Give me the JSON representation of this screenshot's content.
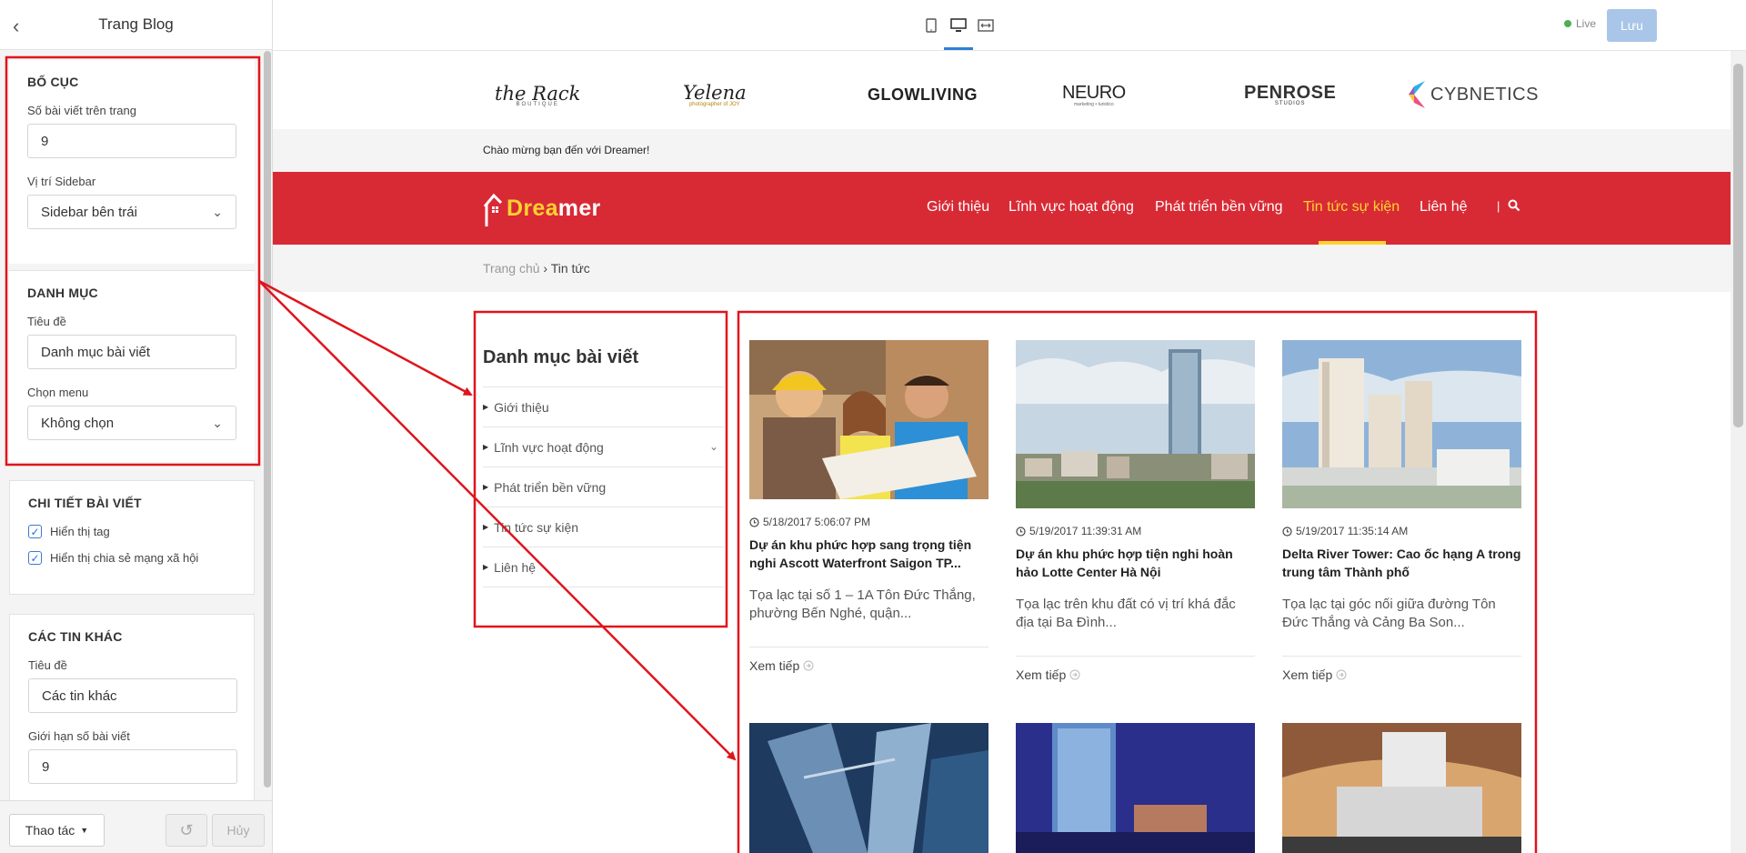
{
  "editor": {
    "title": "Trang Blog",
    "sections": {
      "layout": {
        "title": "BỐ CỤC",
        "posts_per_page_label": "Số bài viết trên trang",
        "posts_per_page_value": "9",
        "sidebar_position_label": "Vị trí Sidebar",
        "sidebar_position_value": "Sidebar bên trái"
      },
      "category": {
        "title": "DANH MỤC",
        "heading_label": "Tiêu đề",
        "heading_value": "Danh mục bài viết",
        "menu_label": "Chọn menu",
        "menu_value": "Không chọn"
      },
      "post_detail": {
        "title": "CHI TIẾT BÀI VIẾT",
        "show_tags": "Hiển thị tag",
        "show_share": "Hiển thị chia sẻ mạng xã hội"
      },
      "other_news": {
        "title": "CÁC TIN KHÁC",
        "heading_label": "Tiêu đề",
        "heading_value": "Các tin khác",
        "limit_label": "Giới hạn số bài viết",
        "limit_value": "9"
      }
    },
    "footer": {
      "actions_label": "Thao tác",
      "cancel_label": "Hủy"
    }
  },
  "toolbar": {
    "live_label": "Live",
    "save_label": "Lưu"
  },
  "site": {
    "partners": [
      "the Rack",
      "Yelena",
      "GLOWLIVING",
      "NEURO",
      "PENROSE",
      "CYBNETICS"
    ],
    "partner_subs": [
      "BOUTIQUE",
      "photographer of JOY",
      "",
      "marketing • turistico",
      "STUDIOS",
      ""
    ],
    "welcome": "Chào mừng bạn đến với Dreamer!",
    "logo_part1": "Drea",
    "logo_part2": "mer",
    "nav": [
      "Giới thiệu",
      "Lĩnh vực hoạt động",
      "Phát triển bền vững",
      "Tin tức sự kiện",
      "Liên hệ"
    ],
    "nav_separator": "|",
    "breadcrumb": {
      "home": "Trang chủ",
      "separator": "›",
      "current": "Tin tức"
    },
    "sidebar": {
      "title": "Danh mục bài viết",
      "items": [
        "Giới thiệu",
        "Lĩnh vực hoạt động",
        "Phát triển bền vững",
        "Tin tức sự kiện",
        "Liên hệ"
      ]
    },
    "read_more": "Xem tiếp",
    "posts": [
      {
        "date": "5/18/2017 5:06:07 PM",
        "title": "Dự án khu phức hợp sang trọng tiện nghi Ascott Waterfront Saigon TP...",
        "excerpt": "Tọa lạc tại số 1 – 1A Tôn Đức Thắng, phường Bến Nghé, quận..."
      },
      {
        "date": "5/19/2017 11:39:31 AM",
        "title": "Dự án khu phức hợp tiện nghi hoàn hảo Lotte Center Hà Nội",
        "excerpt": "Tọa lạc trên khu đất có vị trí khá đắc địa tại Ba Đình..."
      },
      {
        "date": "5/19/2017 11:35:14 AM",
        "title": "Delta River Tower: Cao ốc hạng A trong trung tâm Thành phố",
        "excerpt": "Tọa lạc tại góc nối giữa đường Tôn Đức Thắng và Cảng Ba Son..."
      }
    ]
  },
  "colors": {
    "brand_red": "#d82a35",
    "nav_active": "#ffd230",
    "annotation_red": "#e0141c",
    "save_button": "#a9c6e8",
    "live_dot": "#4caf50"
  }
}
